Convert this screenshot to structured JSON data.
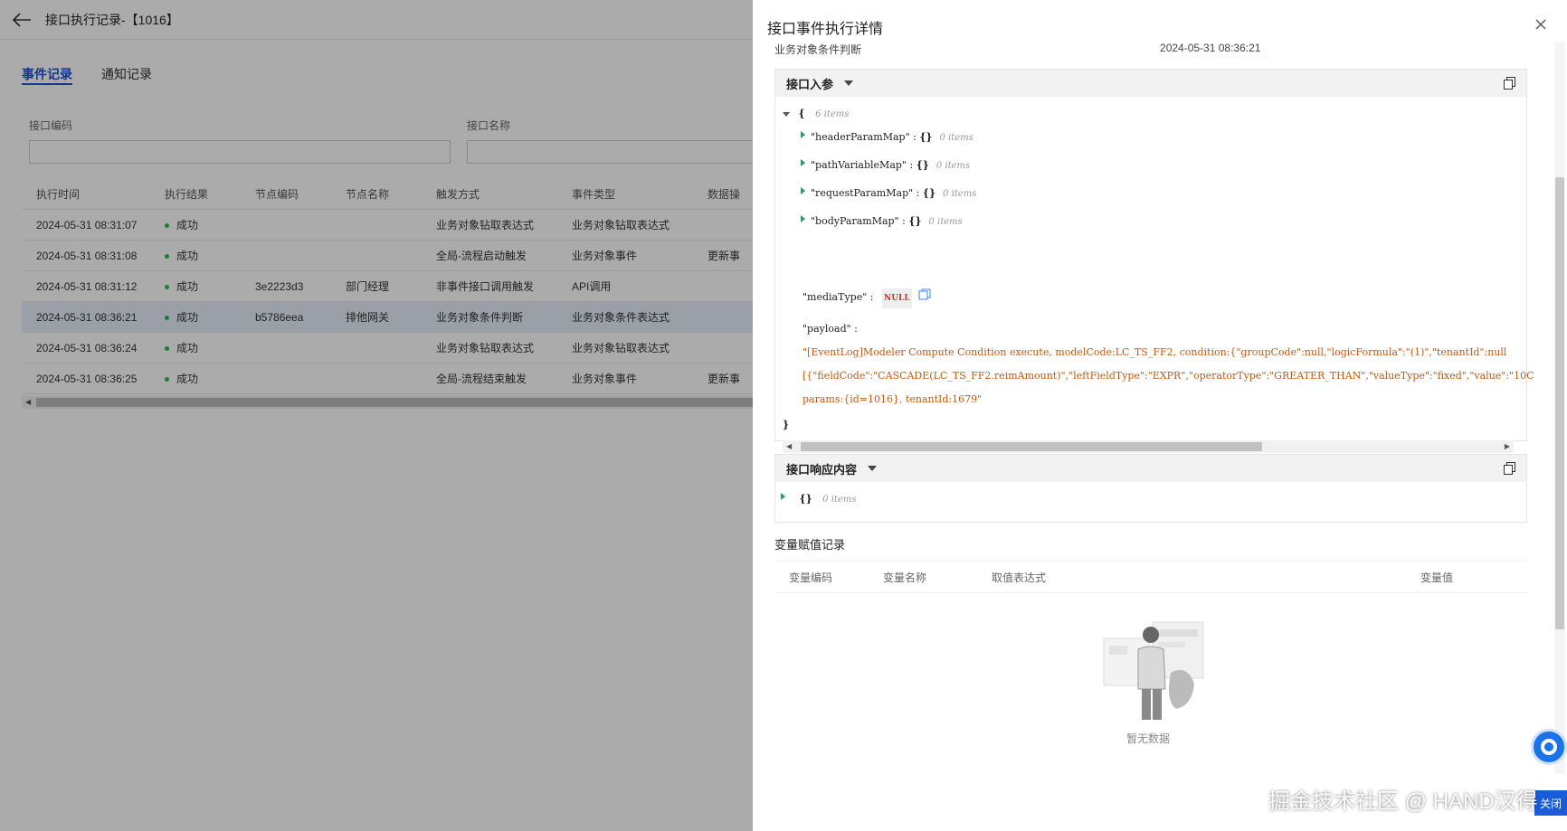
{
  "page": {
    "title": "接口执行记录-【1016】",
    "tabs": [
      {
        "label": "事件记录",
        "active": true
      },
      {
        "label": "通知记录",
        "active": false
      }
    ],
    "filters": [
      {
        "label": "接口编码",
        "value": ""
      },
      {
        "label": "接口名称",
        "value": ""
      }
    ],
    "table": {
      "headers": [
        "执行时间",
        "执行结果",
        "节点编码",
        "节点名称",
        "触发方式",
        "事件类型",
        "数据操"
      ],
      "rows": [
        [
          "2024-05-31 08:31:07",
          "成功",
          "",
          "",
          "业务对象钻取表达式",
          "业务对象钻取表达式",
          ""
        ],
        [
          "2024-05-31 08:31:08",
          "成功",
          "",
          "",
          "全局-流程启动触发",
          "业务对象事件",
          "更新事"
        ],
        [
          "2024-05-31 08:31:12",
          "成功",
          "3e2223d3",
          "部门经理",
          "非事件接口调用触发",
          "API调用",
          ""
        ],
        [
          "2024-05-31 08:36:21",
          "成功",
          "b5786eea",
          "排他网关",
          "业务对象条件判断",
          "业务对象条件表达式",
          ""
        ],
        [
          "2024-05-31 08:36:24",
          "成功",
          "",
          "",
          "业务对象钻取表达式",
          "业务对象钻取表达式",
          ""
        ],
        [
          "2024-05-31 08:36:25",
          "成功",
          "",
          "",
          "全局-流程结束触发",
          "业务对象事件",
          "更新事"
        ]
      ],
      "selected_row": 3
    }
  },
  "drawer": {
    "title": "接口事件执行详情",
    "event_name": "业务对象条件判断",
    "event_time": "2024-05-31 08:36:21",
    "request_section": {
      "title": "接口入参",
      "root_count": "6 items",
      "entries": [
        {
          "key": "\"headerParamMap\" :",
          "value": "{}",
          "count": "0 items"
        },
        {
          "key": "\"pathVariableMap\" :",
          "value": "{}",
          "count": "0 items"
        },
        {
          "key": "\"requestParamMap\" :",
          "value": "{}",
          "count": "0 items"
        },
        {
          "key": "\"bodyParamMap\" :",
          "value": "{}",
          "count": "0 items"
        }
      ],
      "media_type_key": "\"mediaType\" :",
      "media_type_value": "NULL",
      "payload_key": "\"payload\" :",
      "payload_lines": [
        "\"[EventLog]Modeler Compute Condition execute, modelCode:LC_TS_FF2, condition:{\"groupCode\":null,\"logicFormula\":\"(1)\",\"tenantId\":null",
        "[{\"fieldCode\":\"CASCADE(LC_TS_FF2.reimAmount)\",\"leftFieldType\":\"EXPR\",\"operatorType\":\"GREATER_THAN\",\"valueType\":\"fixed\",\"value\":\"10C",
        "params:{id=1016}, tenantId:1679\""
      ]
    },
    "response_section": {
      "title": "接口响应内容",
      "value": "{}",
      "count": "0 items"
    },
    "variables": {
      "title": "变量赋值记录",
      "headers": [
        "变量编码",
        "变量名称",
        "取值表达式",
        "变量值"
      ],
      "empty_text": "暂无数据"
    },
    "footer_button": "关闭"
  },
  "watermark": "掘金技术社区 @ HAND汉得",
  "colors": {
    "accent": "#1f4fd8",
    "success": "#2db84d",
    "null_red": "#d3302f",
    "string_orange": "#c05a10"
  }
}
